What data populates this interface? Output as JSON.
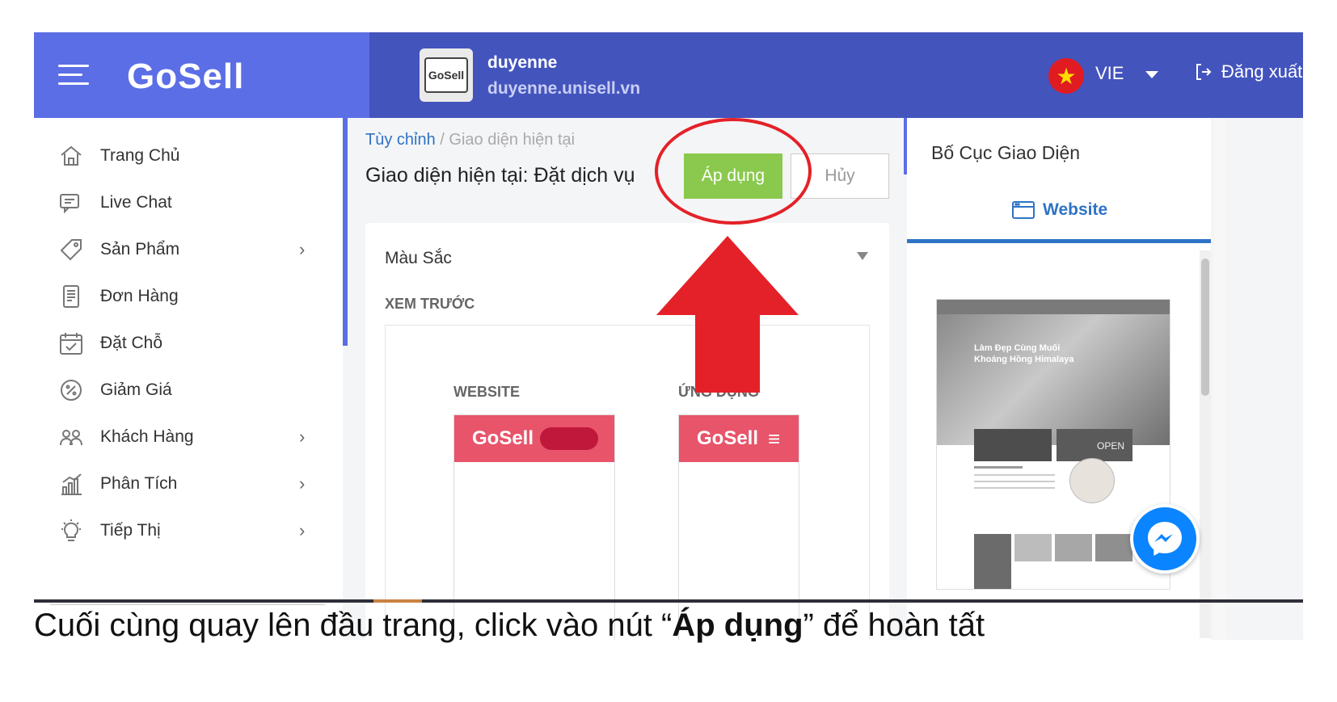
{
  "header": {
    "logo_text": "GoSell",
    "store_name": "duyenne",
    "store_url": "duyenne.unisell.vn",
    "store_avatar_text": "GoSell",
    "language": "VIE",
    "logout_label": "Đăng xuất"
  },
  "sidebar": {
    "items": [
      {
        "label": "Trang Chủ",
        "icon": "home-icon",
        "has_children": false
      },
      {
        "label": "Live Chat",
        "icon": "chat-icon",
        "has_children": false
      },
      {
        "label": "Sản Phẩm",
        "icon": "tag-icon",
        "has_children": true
      },
      {
        "label": "Đơn Hàng",
        "icon": "receipt-icon",
        "has_children": false
      },
      {
        "label": "Đặt Chỗ",
        "icon": "calendar-check-icon",
        "has_children": false
      },
      {
        "label": "Giảm Giá",
        "icon": "discount-icon",
        "has_children": false
      },
      {
        "label": "Khách Hàng",
        "icon": "customers-icon",
        "has_children": true
      },
      {
        "label": "Phân Tích",
        "icon": "analytics-icon",
        "has_children": true
      },
      {
        "label": "Tiếp Thị",
        "icon": "lightbulb-icon",
        "has_children": true
      }
    ]
  },
  "main": {
    "breadcrumb": {
      "parent": "Tùy chỉnh",
      "separator": "/",
      "current": "Giao diện hiện tại"
    },
    "page_title": "Giao diện hiện tại: Đặt dịch vụ",
    "apply_label": "Áp dụng",
    "cancel_label": "Hủy",
    "card": {
      "title": "Màu Sắc",
      "preview_label": "XEM TRƯỚC",
      "website_label": "WEBSITE",
      "app_label": "ỨNG DỤNG",
      "preview_logo": "GoSell"
    }
  },
  "right_panel": {
    "title": "Bố Cục Giao Diện",
    "tab_label": "Website",
    "thumb_headline_1": "Làm Đẹp Cùng Muối",
    "thumb_headline_2": "Khoáng Hồng Himalaya",
    "thumb_open_sign": "OPEN"
  },
  "caption": {
    "before": "Cuối cùng quay lên đầu trang, click vào nút “",
    "bold": "Áp dụng",
    "after": "” để hoàn tất"
  },
  "colors": {
    "header_left": "#5b6ee6",
    "header_right": "#4354bd",
    "apply_green": "#8ac94d",
    "preview_pink": "#e8546a",
    "annotation_red": "#e42128",
    "link_blue": "#2f73c5"
  }
}
